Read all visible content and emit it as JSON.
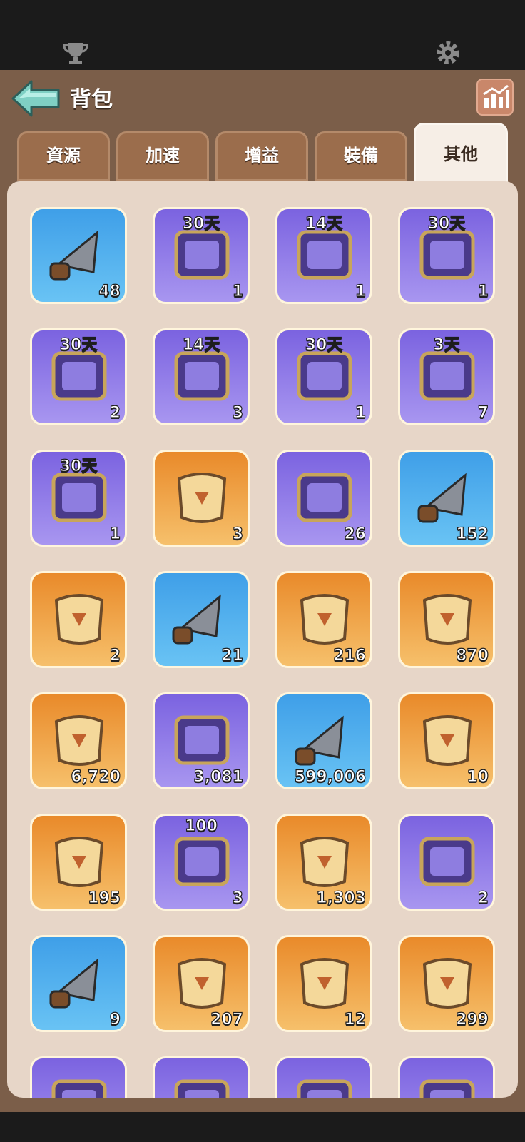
{
  "status_bar": {
    "left_icon": "trophy-icon",
    "right_icon": "gear-icon"
  },
  "header": {
    "title": "背包",
    "back_icon": "arrow-left-icon",
    "stats_icon": "chart-icon"
  },
  "tabs": [
    {
      "label": "資源",
      "active": false
    },
    {
      "label": "加速",
      "active": false
    },
    {
      "label": "增益",
      "active": false
    },
    {
      "label": "裝備",
      "active": false
    },
    {
      "label": "其他",
      "active": true
    }
  ],
  "items": [
    {
      "icon": "arrowhead-icon",
      "color": "blue",
      "count": "48",
      "duration": ""
    },
    {
      "icon": "octopus-island-icon",
      "color": "purple",
      "count": "1",
      "duration": "30天"
    },
    {
      "icon": "castle-island-icon",
      "color": "purple",
      "count": "1",
      "duration": "14天"
    },
    {
      "icon": "pirate-ship-icon",
      "color": "purple",
      "count": "1",
      "duration": "30天"
    },
    {
      "icon": "octopus-frame-icon",
      "color": "purple",
      "count": "2",
      "duration": "30天"
    },
    {
      "icon": "stone-frame-icon",
      "color": "purple",
      "count": "3",
      "duration": "14天"
    },
    {
      "icon": "gold-frame-icon",
      "color": "purple",
      "count": "1",
      "duration": "30天"
    },
    {
      "icon": "cloud-frame-icon",
      "color": "purple",
      "count": "7",
      "duration": "3天"
    },
    {
      "icon": "royal-frame-icon",
      "color": "purple",
      "count": "1",
      "duration": "30天"
    },
    {
      "icon": "hero-portrait-icon",
      "color": "orange",
      "count": "3",
      "duration": ""
    },
    {
      "icon": "green-potion-icon",
      "color": "purple",
      "count": "26",
      "duration": ""
    },
    {
      "icon": "paw-book-icon",
      "color": "blue",
      "count": "152",
      "duration": ""
    },
    {
      "icon": "gold-rune-stone-icon",
      "color": "orange",
      "count": "2",
      "duration": ""
    },
    {
      "icon": "silver-rune-stone-icon",
      "color": "blue",
      "count": "21",
      "duration": ""
    },
    {
      "icon": "diamond-scroll-icon",
      "color": "orange",
      "count": "216",
      "duration": ""
    },
    {
      "icon": "diamond-book-icon",
      "color": "orange",
      "count": "870",
      "duration": ""
    },
    {
      "icon": "blueprint-scroll-icon",
      "color": "orange",
      "count": "6,720",
      "duration": ""
    },
    {
      "icon": "rope-spool-icon",
      "color": "purple",
      "count": "3,081",
      "duration": ""
    },
    {
      "icon": "map-scroll-icon",
      "color": "blue",
      "count": "599,006",
      "duration": ""
    },
    {
      "icon": "crystal-icon",
      "color": "orange",
      "count": "10",
      "duration": ""
    },
    {
      "icon": "crown-hammer-icon",
      "color": "orange",
      "count": "195",
      "duration": ""
    },
    {
      "icon": "bronze-plate-icon",
      "color": "purple",
      "count": "3",
      "duration": "100"
    },
    {
      "icon": "orange-puzzle-icon",
      "color": "orange",
      "count": "1,303",
      "duration": ""
    },
    {
      "icon": "purple-puzzle-icon",
      "color": "purple",
      "count": "2",
      "duration": ""
    },
    {
      "icon": "blue-puzzle-icon",
      "color": "blue",
      "count": "9",
      "duration": ""
    },
    {
      "icon": "hero-puzzle-icon",
      "color": "orange",
      "count": "207",
      "duration": ""
    },
    {
      "icon": "nun-hero-puzzle-icon",
      "color": "orange",
      "count": "12",
      "duration": ""
    },
    {
      "icon": "blonde-hero-puzzle-icon",
      "color": "orange",
      "count": "299",
      "duration": ""
    },
    {
      "icon": "hero-puzzle-icon",
      "color": "purple",
      "count": "",
      "duration": ""
    },
    {
      "icon": "hero-puzzle-icon",
      "color": "purple",
      "count": "",
      "duration": ""
    },
    {
      "icon": "hero-puzzle-icon",
      "color": "purple",
      "count": "",
      "duration": ""
    },
    {
      "icon": "hero-puzzle-icon",
      "color": "purple",
      "count": "",
      "duration": ""
    }
  ],
  "colors": {
    "blue": "#3f9fe8",
    "purple": "#7b63e0",
    "orange": "#e98a2a",
    "background": "#7b5e49",
    "panel": "#e7d6c8"
  }
}
